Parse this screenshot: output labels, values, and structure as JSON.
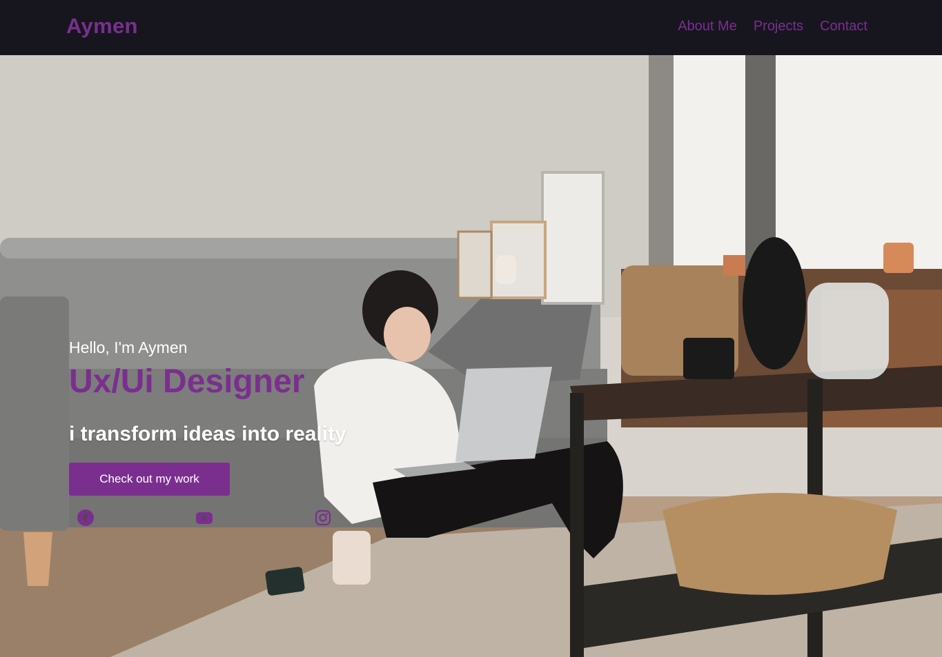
{
  "nav": {
    "brand": "Aymen",
    "links": [
      {
        "label": "About Me"
      },
      {
        "label": "Projects"
      },
      {
        "label": "Contact"
      }
    ]
  },
  "hero": {
    "greeting": "Hello, I'm Aymen",
    "role": "Ux/Ui Designer",
    "tagline": "i transform ideas into reality",
    "cta_label": "Check out my work",
    "image_alt": "woman working on a laptop while sitting on the floor of a living room"
  },
  "social": [
    {
      "icon": "facebook-icon"
    },
    {
      "icon": "youtube-icon"
    },
    {
      "icon": "instagram-icon"
    }
  ],
  "colors": {
    "accent": "#7a2f8f",
    "nav_bg": "#17161f",
    "text_light": "#ffffff"
  }
}
